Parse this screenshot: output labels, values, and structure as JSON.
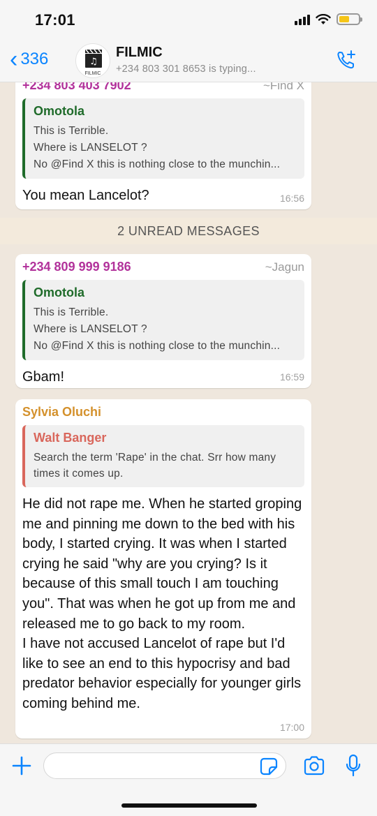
{
  "status_bar": {
    "time": "17:01"
  },
  "header": {
    "back_count": "336",
    "group_name": "FILMIC",
    "subtitle": "+234 803 301 8653 is typing...",
    "avatar_text": "FILMIC"
  },
  "messages": [
    {
      "sender": "+234 803 403 7902",
      "sender_color": "#b2329b",
      "alias": "~Find X",
      "quote": {
        "author": "Omotola",
        "author_color": "#1f6b2a",
        "lines": [
          "This is Terrible.",
          "Where is LANSELOT ?",
          "No @Find X this is nothing close to the munchin..."
        ]
      },
      "text": "You mean Lancelot?",
      "time": "16:56"
    },
    {
      "sender": "+234 809 999 9186",
      "sender_color": "#b2329b",
      "alias": "~Jagun",
      "quote": {
        "author": "Omotola",
        "author_color": "#1f6b2a",
        "lines": [
          "This is Terrible.",
          "Where is LANSELOT ?",
          "No @Find X this is nothing close to the munchin..."
        ]
      },
      "text": "Gbam!",
      "time": "16:59"
    },
    {
      "sender": "Sylvia Oluchi",
      "sender_color": "#d4912c",
      "alias": "",
      "quote": {
        "author": "Walt Banger",
        "author_color": "#d9675c",
        "text": "Search the term 'Rape' in the chat. Srr how many times it comes up."
      },
      "text": "He did not rape me. When he started groping me and pinning me down to the bed with his body, I started crying. It was when I started crying he said \"why are you crying? Is it because of this small touch I am touching you\". That was when he got up from me and released me to go back to my room.\nI have not accused Lancelot of rape but I'd like to see an end to this hypocrisy and bad predator behavior especially for younger girls coming behind me.",
      "time": "17:00"
    }
  ],
  "unread_label": "2 UNREAD MESSAGES",
  "colors": {
    "accent": "#0a84ff",
    "chat_bg": "#efe7dd"
  }
}
